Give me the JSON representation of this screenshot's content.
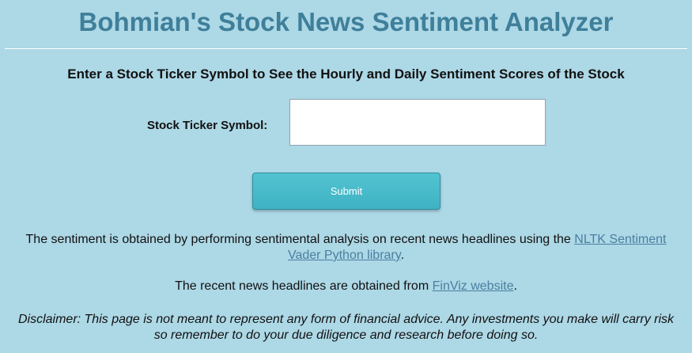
{
  "header": {
    "title": "Bohmian's Stock News Sentiment Analyzer"
  },
  "form": {
    "subtitle": "Enter a Stock Ticker Symbol to See the Hourly and Daily Sentiment Scores of the Stock",
    "ticker_label": "Stock Ticker Symbol:",
    "ticker_value": "",
    "submit_label": "Submit"
  },
  "info": {
    "line1_prefix": "The sentiment is obtained by performing sentimental analysis on recent news headlines using the ",
    "line1_link": "NLTK Sentiment Vader Python library",
    "line1_suffix": ".",
    "line2_prefix": "The recent news headlines are obtained from ",
    "line2_link": "FinViz website",
    "line2_suffix": ".",
    "disclaimer": "Disclaimer: This page is not meant to represent any form of financial advice. Any investments you make will carry risk so remember to do your due diligence and research before doing so."
  },
  "colors": {
    "background": "#add8e6",
    "title": "#3f7f9a",
    "button": "#4ab9c9",
    "link": "#4b7fa0"
  }
}
